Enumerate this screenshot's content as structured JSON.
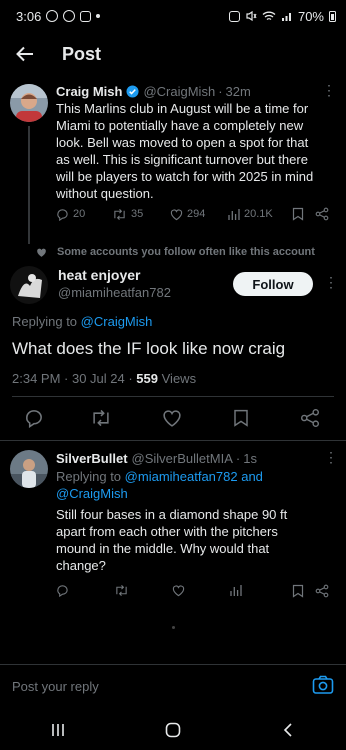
{
  "status_bar": {
    "time": "3:06",
    "battery": "70%"
  },
  "header": {
    "title": "Post"
  },
  "main_tweet": {
    "author_name": "Craig Mish",
    "handle": "@CraigMish",
    "separator": "·",
    "time": "32m",
    "lines": [
      "This Marlins club in August will be a time for",
      "Miami to potentially have a completely new",
      "look. Bell was moved to open a spot for that",
      "as well. This is significant turnover but there",
      "will be players to watch for with 2025 in mind",
      "without question."
    ],
    "replies": "20",
    "reposts": "35",
    "likes": "294",
    "views": "20.1K"
  },
  "social_context": "Some accounts you follow often like this account",
  "focused_tweet": {
    "author_name": "heat enjoyer",
    "handle": "@miamiheatfan782",
    "follow_label": "Follow",
    "replying_prefix": "Replying to",
    "replying_to": "@CraigMish",
    "text": "What does the IF look like now craig",
    "timestamp": "2:34 PM · 30 Jul 24 ·",
    "views_count": "559",
    "views_label": "Views"
  },
  "reply_tweet": {
    "author_name": "SilverBullet",
    "handle": "@SilverBulletMIA",
    "separator": "·",
    "time": "1s",
    "replying_prefix": "Replying to",
    "replying_to_1": "@miamiheatfan782 and",
    "replying_to_2": "@CraigMish",
    "lines": [
      "Still four bases in a diamond shape 90 ft",
      "apart from each other with the pitchers",
      "mound in the middle. Why would that",
      "change?"
    ]
  },
  "reply_box": {
    "placeholder": "Post your reply"
  },
  "colors": {
    "accent": "#1d9bf0",
    "background": "#000000",
    "muted": "#71767b",
    "divider": "#2f3336"
  }
}
